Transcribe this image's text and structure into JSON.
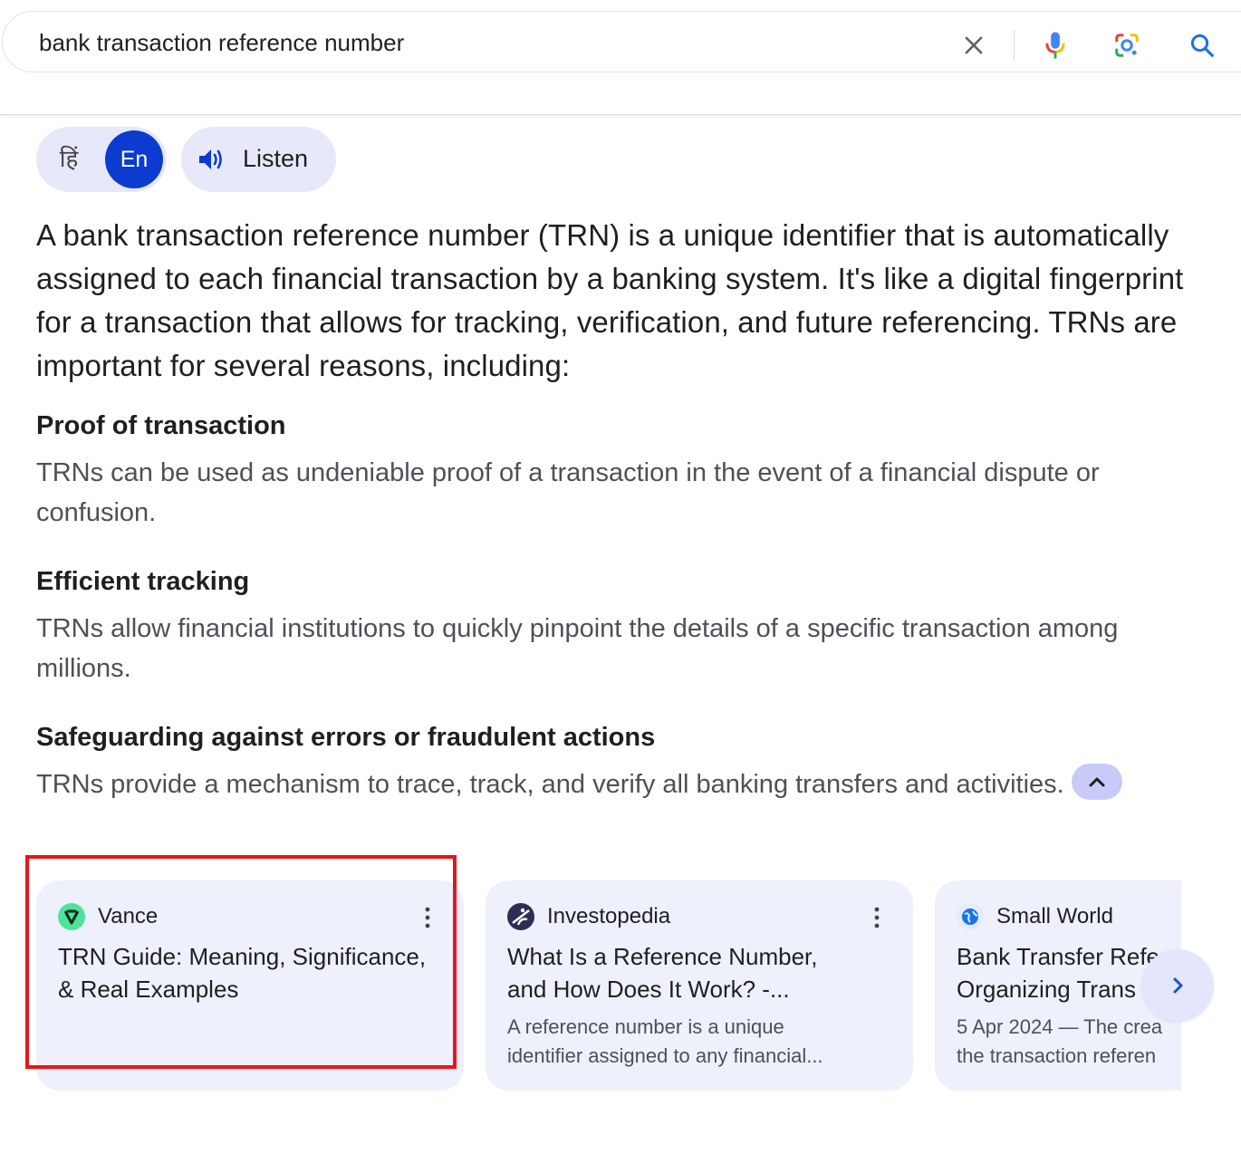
{
  "search": {
    "query": "bank transaction reference number"
  },
  "language": {
    "hindi_label": "हिं",
    "english_label": "En",
    "listen_label": "Listen"
  },
  "answer": {
    "summary": "A bank transaction reference number (TRN) is a unique identifier that is automatically assigned to each financial transaction by a banking system. It's like a digital fingerprint for a transaction that allows for tracking, verification, and future referencing. TRNs are important for several reasons, including:",
    "points": [
      {
        "heading": "Proof of transaction",
        "text": "TRNs can be used as undeniable proof of a transaction in the event of a financial dispute or confusion."
      },
      {
        "heading": "Efficient tracking",
        "text": "TRNs allow financial institutions to quickly pinpoint the details of a specific transaction among millions."
      },
      {
        "heading": "Safeguarding against errors or fraudulent actions",
        "text": "TRNs provide a mechanism to trace, track, and verify all banking transfers and activities."
      }
    ]
  },
  "sources": [
    {
      "name": "Vance",
      "title": "TRN Guide: Meaning, Significance, & Real Examples",
      "snippet": "",
      "favicon_color": "#4fe39a"
    },
    {
      "name": "Investopedia",
      "title_line1": "What Is a Reference Number,",
      "title_line2": "and How Does It Work? -...",
      "snippet_line1": "A reference number is a unique",
      "snippet_line2": "identifier assigned to any financial...",
      "favicon_color": "#2b2f52"
    },
    {
      "name": "Small World",
      "title_line1": "Bank Transfer Refe",
      "title_line2": "Organizing Trans",
      "snippet_line1": "5 Apr 2024 — The crea",
      "snippet_line2": "the transaction referen",
      "favicon_color": "#1a73e8"
    }
  ],
  "colors": {
    "accent": "#0b3ccf",
    "pill_bg": "#e8e8fb",
    "card_bg": "#eef0fb",
    "highlight": "#e8151b"
  },
  "icons": [
    "close-icon",
    "microphone-icon",
    "lens-icon",
    "search-icon",
    "speaker-icon",
    "chevron-up-icon",
    "more-vert-icon",
    "chevron-right-icon"
  ]
}
